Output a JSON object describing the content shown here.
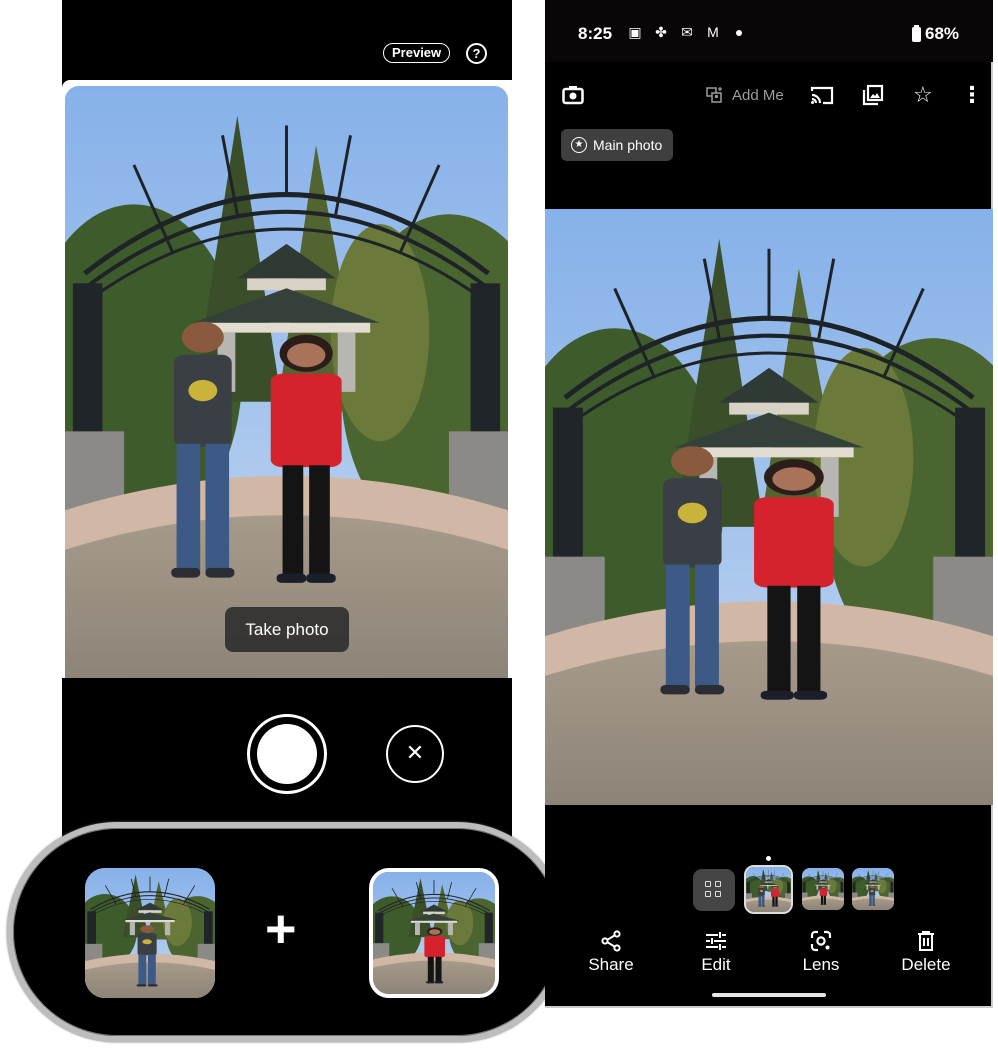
{
  "left_screen": {
    "topbar": {
      "preview_label": "Preview",
      "help_icon": "question-circle-icon",
      "help_glyph": "?"
    },
    "viewfinder": {
      "hint_chip": "Take photo",
      "subjects": [
        "man in grey t-shirt",
        "woman in red shirt"
      ]
    },
    "controls": {
      "shutter_icon": "shutter-button",
      "cancel_icon": "close-icon",
      "cancel_glyph": "✕"
    },
    "capture_summary": {
      "first_shot": "photo with man only",
      "second_shot": "photo with woman only (selected)",
      "join_glyph": "+"
    }
  },
  "right_screen": {
    "status_bar": {
      "time": "8:25",
      "notification_icons": [
        "teams-icon",
        "pinwheel-icon",
        "outlook-icon",
        "gmail-icon"
      ],
      "notification_glyphs": [
        "▣",
        "✤",
        "✉",
        "M"
      ],
      "battery_percent": "68%"
    },
    "app_bar": {
      "camera_icon": "camera-icon",
      "add_me_label": "Add Me",
      "cast_icon": "cast-icon",
      "album_icon": "add-to-album-icon",
      "favorite_icon": "star-icon",
      "favorite_glyph": "☆",
      "more_icon": "more-vert-icon",
      "more_glyph": "⋮"
    },
    "main_photo_chip": {
      "label": "Main photo",
      "glyph": "★"
    },
    "filmstrip": {
      "items": [
        {
          "type": "grid-view",
          "icon": "grid-icon"
        },
        {
          "type": "thumbnail",
          "subject": "both people",
          "active": true
        },
        {
          "type": "thumbnail",
          "subject": "woman only",
          "active": false
        },
        {
          "type": "thumbnail",
          "subject": "man only",
          "active": false
        }
      ]
    },
    "actions": [
      {
        "label": "Share",
        "icon": "share-icon"
      },
      {
        "label": "Edit",
        "icon": "tune-icon"
      },
      {
        "label": "Lens",
        "icon": "lens-icon"
      },
      {
        "label": "Delete",
        "icon": "trash-icon"
      }
    ]
  }
}
